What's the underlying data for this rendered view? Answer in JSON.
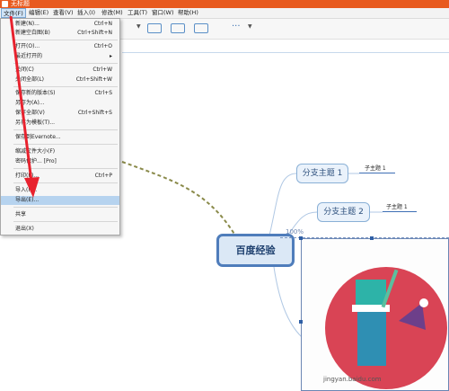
{
  "window": {
    "title": "无标题"
  },
  "menubar": {
    "items": [
      "文件(F)",
      "编辑(E)",
      "查看(V)",
      "插入(I)",
      "修改(M)",
      "工具(T)",
      "窗口(W)",
      "帮助(H)"
    ]
  },
  "file_menu": {
    "items": [
      {
        "label": "新建(N)...",
        "shortcut": "Ctrl+N"
      },
      {
        "label": "新建空白图(B)",
        "shortcut": "Ctrl+Shift+N"
      },
      {
        "label": "打开(O)...",
        "shortcut": "Ctrl+O"
      },
      {
        "label": "最近打开的",
        "shortcut": "▸"
      },
      {
        "label": "关闭(C)",
        "shortcut": "Ctrl+W"
      },
      {
        "label": "关闭全部(L)",
        "shortcut": "Ctrl+Shift+W"
      },
      {
        "label": "保存新的版本(S)",
        "shortcut": "Ctrl+S"
      },
      {
        "label": "另存为(A)...",
        "shortcut": ""
      },
      {
        "label": "保存全部(V)",
        "shortcut": "Ctrl+Shift+S"
      },
      {
        "label": "另存为模板(T)...",
        "shortcut": ""
      },
      {
        "label": "保存到Evernote...",
        "shortcut": ""
      },
      {
        "label": "缩减文件大小(F)",
        "shortcut": ""
      },
      {
        "label": "密码保护... [Pro]",
        "shortcut": ""
      },
      {
        "label": "打印(P)...",
        "shortcut": "Ctrl+P"
      },
      {
        "label": "导入(I)...",
        "shortcut": ""
      },
      {
        "label": "导出(E)...",
        "shortcut": ""
      },
      {
        "label": "共享",
        "shortcut": ""
      },
      {
        "label": "退出(X)",
        "shortcut": ""
      }
    ]
  },
  "mindmap": {
    "central": "百度经验",
    "branch1": "分支主题 1",
    "branch2": "分支主题 2",
    "sub1": "子主题 1",
    "sub2": "子主题 1",
    "zoom_label": "100%"
  },
  "watermark": {
    "text": "jingyan.baidu.com"
  },
  "colors": {
    "titlebar": "#e85a1f",
    "central_border": "#4f7dbb",
    "image_circle": "#d94455"
  }
}
